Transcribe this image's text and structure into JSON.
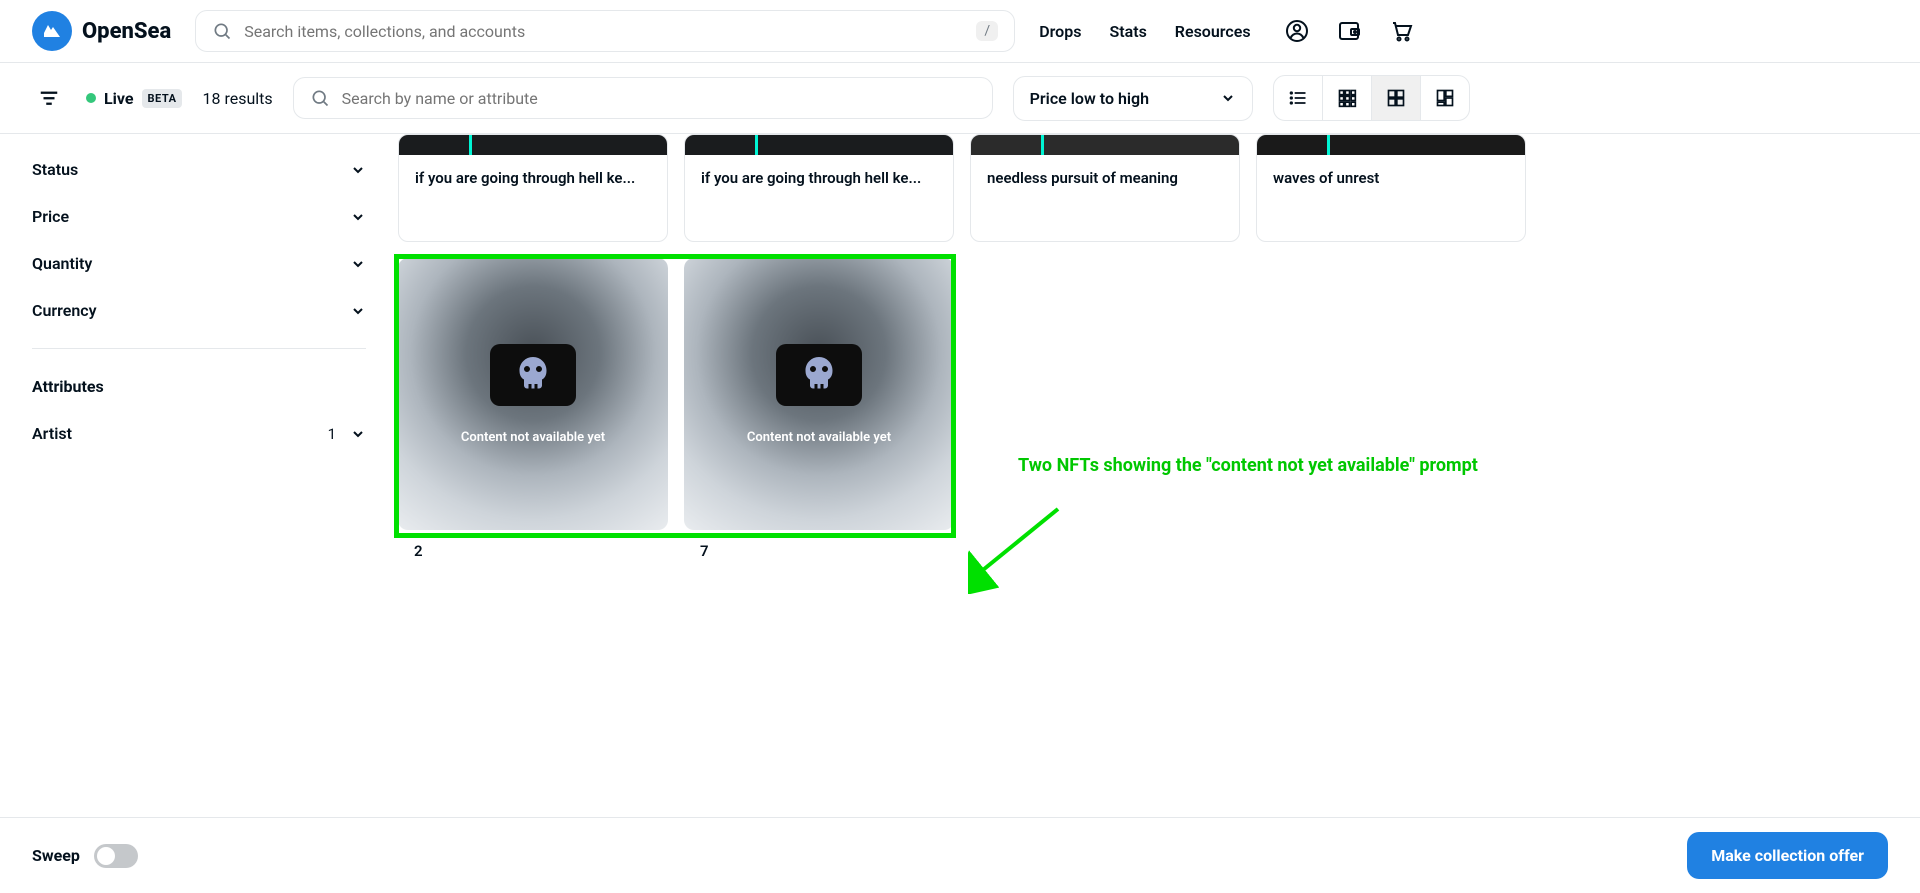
{
  "brand": "OpenSea",
  "search_main_placeholder": "Search items, collections, and accounts",
  "search_kbd": "/",
  "nav": {
    "drops": "Drops",
    "stats": "Stats",
    "resources": "Resources"
  },
  "toolbar": {
    "live": "Live",
    "beta": "BETA",
    "results": "18 results",
    "sub_search_placeholder": "Search by name or attribute",
    "sort": "Price low to high"
  },
  "sidebar": {
    "status": "Status",
    "price": "Price",
    "quantity": "Quantity",
    "currency": "Currency",
    "attributes_heading": "Attributes",
    "artist": "Artist",
    "artist_count": "1"
  },
  "cards_row1": [
    {
      "title": "if you are going through hell ke..."
    },
    {
      "title": "if you are going through hell ke..."
    },
    {
      "title": "needless pursuit of meaning"
    },
    {
      "title": "waves of unrest"
    }
  ],
  "cards_row2": [
    {
      "title": "2",
      "placeholder_text": "Content not available yet"
    },
    {
      "title": "7",
      "placeholder_text": "Content not available yet"
    }
  ],
  "annotation": "Two NFTs showing the \"content not yet available\" prompt",
  "footer": {
    "sweep": "Sweep",
    "offer": "Make collection offer"
  }
}
